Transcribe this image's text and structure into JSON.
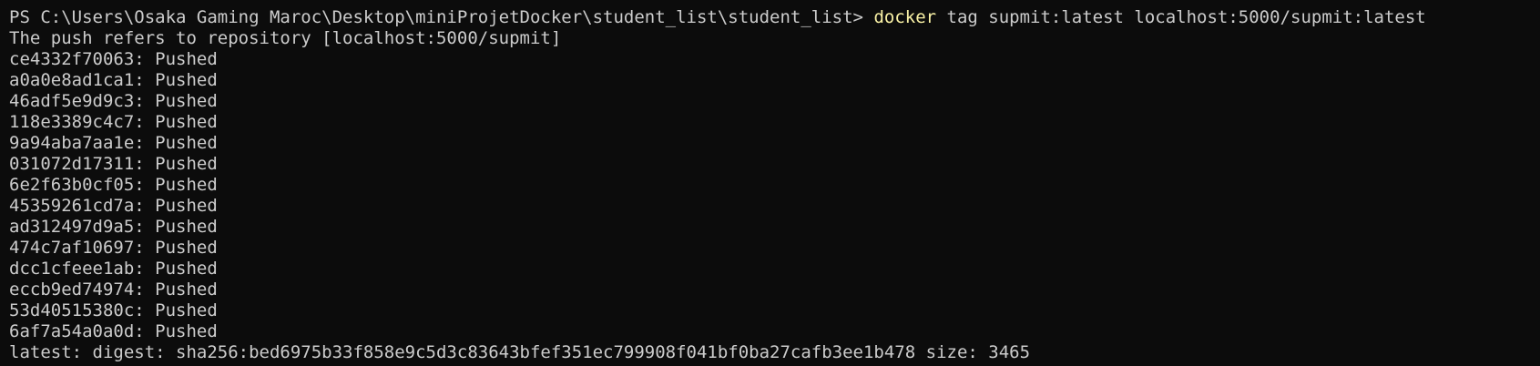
{
  "terminal": {
    "prompt": "PS C:\\Users\\Osaka Gaming Maroc\\Desktop\\miniProjetDocker\\student_list\\student_list> ",
    "command_keyword": "docker",
    "command_args": " tag supmit:latest localhost:5000/supmit:latest",
    "push_header": "The push refers to repository [localhost:5000/supmit]",
    "layers": [
      "ce4332f70063: Pushed",
      "a0a0e8ad1ca1: Pushed",
      "46adf5e9d9c3: Pushed",
      "118e3389c4c7: Pushed",
      "9a94aba7aa1e: Pushed",
      "031072d17311: Pushed",
      "6e2f63b0cf05: Pushed",
      "45359261cd7a: Pushed",
      "ad312497d9a5: Pushed",
      "474c7af10697: Pushed",
      "dcc1cfeee1ab: Pushed",
      "eccb9ed74974: Pushed",
      "53d40515380c: Pushed",
      "6af7a54a0a0d: Pushed"
    ],
    "digest_line": "latest: digest: sha256:bed6975b33f858e9c5d3c83643bfef351ec799908f041bf0ba27cafb3ee1b478 size: 3465"
  },
  "colors": {
    "background": "#0c0c0c",
    "text": "#cccccc",
    "command_highlight": "#f9f1a5"
  }
}
